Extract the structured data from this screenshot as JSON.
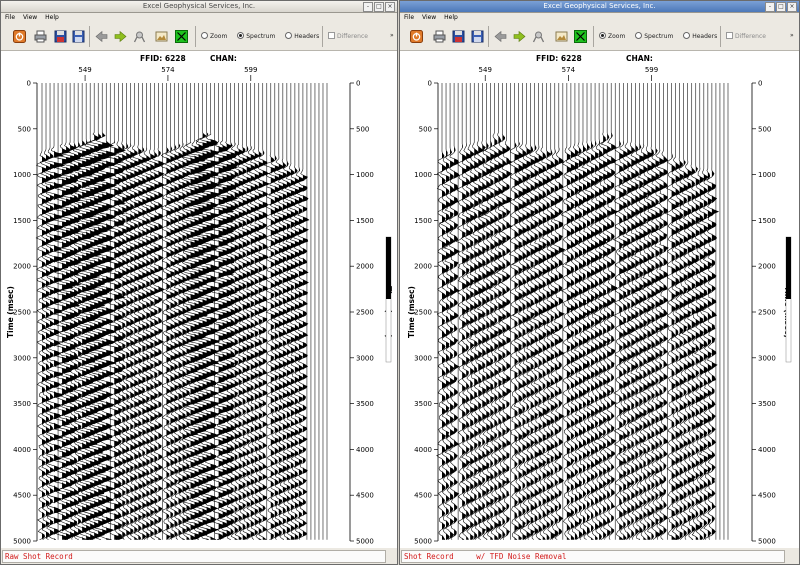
{
  "app_title": "Excel Geophysical Services, Inc.",
  "menu": [
    "File",
    "View",
    "Help"
  ],
  "view_modes": [
    {
      "label": "Zoom"
    },
    {
      "label": "Spectrum"
    },
    {
      "label": "Headers"
    }
  ],
  "difference_label": "Difference",
  "more_label": "»",
  "header": {
    "ffid_label": "FFID:",
    "ffid_value": "6228",
    "chan_label": "CHAN:"
  },
  "time_axis_label": "Time (msec)",
  "channel_ticks": [
    "549",
    "574",
    "599"
  ],
  "time_ticks": [
    "0",
    "500",
    "1000",
    "1500",
    "2000",
    "2500",
    "3000",
    "3500",
    "4000",
    "4500",
    "5000"
  ],
  "window_buttons": [
    "-",
    "□",
    "×"
  ],
  "panels": [
    {
      "id": "left",
      "selected_mode": "Spectrum",
      "status_text": "Raw Shot Record",
      "colors": {
        "trace": "#000000"
      },
      "chart_data": {
        "type": "seismic-wiggle",
        "x": {
          "label": "",
          "tick_values": [
            549,
            574,
            599
          ]
        },
        "y": {
          "label": "Time (msec)",
          "range": [
            0,
            5000
          ],
          "tick_step": 500,
          "reversed": true
        },
        "num_traces": 72,
        "noise": "high"
      }
    },
    {
      "id": "right",
      "selected_mode": "Zoom",
      "status_text": "Shot Record     w/ TFD Noise Removal",
      "colors": {
        "trace": "#000000"
      },
      "chart_data": {
        "type": "seismic-wiggle",
        "x": {
          "label": "",
          "tick_values": [
            549,
            574,
            599
          ]
        },
        "y": {
          "label": "Time (msec)",
          "range": [
            0,
            5000
          ],
          "tick_step": 500,
          "reversed": true
        },
        "num_traces": 72,
        "noise": "low"
      }
    }
  ]
}
